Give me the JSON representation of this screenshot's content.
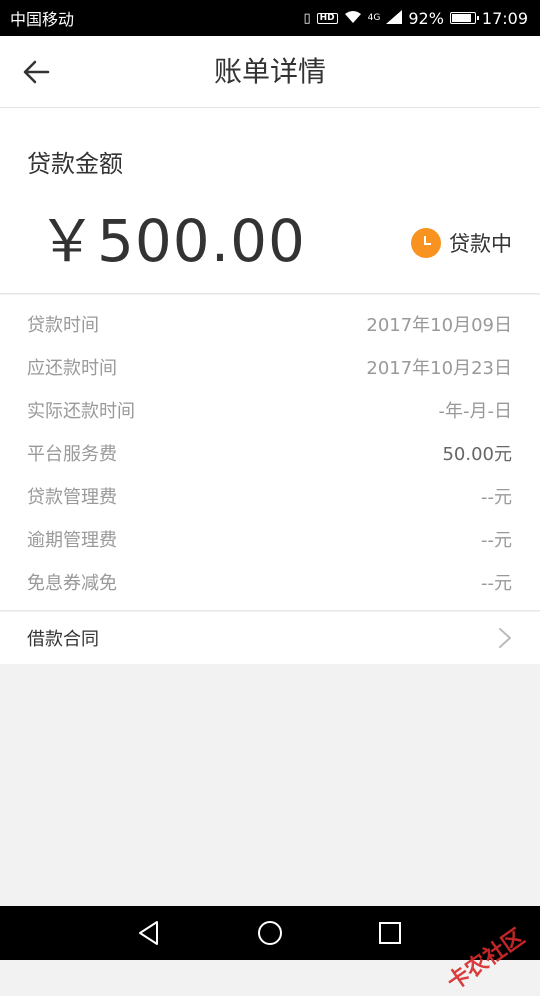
{
  "status_bar": {
    "carrier": "中国移动",
    "network": "4G",
    "hd": "HD",
    "battery_percent": "92%",
    "battery_level": 0.92,
    "time": "17:09"
  },
  "header": {
    "title": "账单详情",
    "back_icon": "arrow-left-icon"
  },
  "loan": {
    "amount_label": "贷款金额",
    "amount": "￥500.00",
    "status": "贷款中",
    "status_color": "#f7931e"
  },
  "details": [
    {
      "label": "贷款时间",
      "value": "2017年10月09日"
    },
    {
      "label": "应还款时间",
      "value": "2017年10月23日"
    },
    {
      "label": "实际还款时间",
      "value": "-年-月-日"
    },
    {
      "label": "平台服务费",
      "value": "50.00元"
    },
    {
      "label": "贷款管理费",
      "value": "--元"
    },
    {
      "label": "逾期管理费",
      "value": "--元"
    },
    {
      "label": "免息券减免",
      "value": "--元"
    }
  ],
  "contract": {
    "label": "借款合同",
    "icon": "chevron-right-icon"
  },
  "watermark": "卡农社区"
}
